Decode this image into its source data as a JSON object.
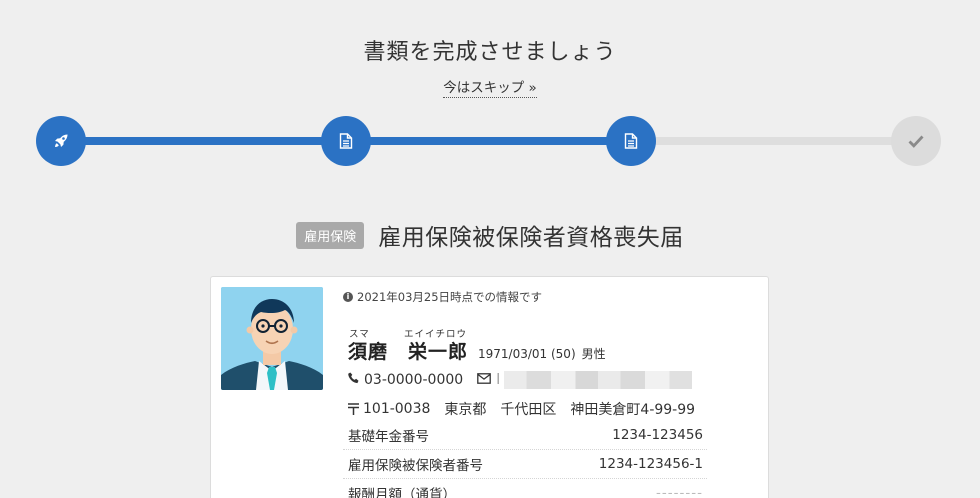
{
  "header": {
    "title": "書類を完成させましょう",
    "skip_label": "今はスキップ »"
  },
  "stepper": {
    "steps": [
      {
        "icon": "rocket-icon",
        "state": "done"
      },
      {
        "icon": "document-icon",
        "state": "done"
      },
      {
        "icon": "document-icon",
        "state": "current"
      },
      {
        "icon": "check-icon",
        "state": "pending"
      }
    ],
    "active_color": "#2b72c4",
    "pending_color": "#dcdcdc"
  },
  "document": {
    "badge": "雇用保険",
    "title": "雇用保険被保険者資格喪失届"
  },
  "employee": {
    "info_note": "2021年03月25日時点での情報です",
    "ruby_family": "スマ",
    "ruby_given": "エイイチロウ",
    "name": "須磨　栄一郎",
    "birth": "1971/03/01 (50)",
    "gender": "男性",
    "phone": "03-0000-0000",
    "email_prefix": "l",
    "postal": "101-0038",
    "pref": "東京都",
    "city": "千代田区",
    "street": "神田美倉町4-99-99"
  },
  "details": [
    {
      "label": "基礎年金番号",
      "value": "1234-123456"
    },
    {
      "label": "雇用保険被保険者番号",
      "value": "1234-123456-1"
    },
    {
      "label": "報酬月額（通貨）",
      "value": "--------"
    }
  ]
}
